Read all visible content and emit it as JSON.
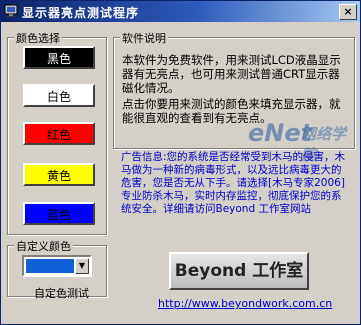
{
  "window": {
    "title": "显示器亮点测试程序",
    "close_glyph": "×",
    "app_icon": "monitor-icon"
  },
  "color_select": {
    "label": "颜色选择",
    "buttons": [
      {
        "label": "黑色",
        "bg": "#000000",
        "fg": "#ffffff"
      },
      {
        "label": "白色",
        "bg": "#ffffff",
        "fg": "#000000"
      },
      {
        "label": "红色",
        "bg": "#ff0000",
        "fg": "#000000"
      },
      {
        "label": "黄色",
        "bg": "#ffff00",
        "fg": "#000000"
      },
      {
        "label": "蓝色",
        "bg": "#0000ff",
        "fg": "#000000"
      }
    ]
  },
  "info": {
    "label": "软件说明",
    "paragraph1": "本软件为免费软件，用来测试LCD液晶显示器有无亮点，也可用来测试普通CRT显示器磁化情况。",
    "paragraph2": "点击你要用来测试的颜色来填充显示器，就能很直观的查看到有无亮点。",
    "ad": "广告信息:您的系统是否经常受到木马的侵害，木马做为一种新的病毒形式，以及远比病毒更大的危害，您是否无从下手。请选择[木马专家2006]专业防杀木马，实时内存监控，彻底保护您的系统安全。详细请访问Beyond 工作室网站"
  },
  "custom_color": {
    "label": "自定义颜色",
    "swatch_color": "#1060d8",
    "test_label": "自定色测试"
  },
  "beyond_button": {
    "label": "Beyond 工作室"
  },
  "website": {
    "url": "http://www.beyondwork.com.cn"
  },
  "watermark": {
    "text": "eNet",
    "sub": "网络学院"
  }
}
